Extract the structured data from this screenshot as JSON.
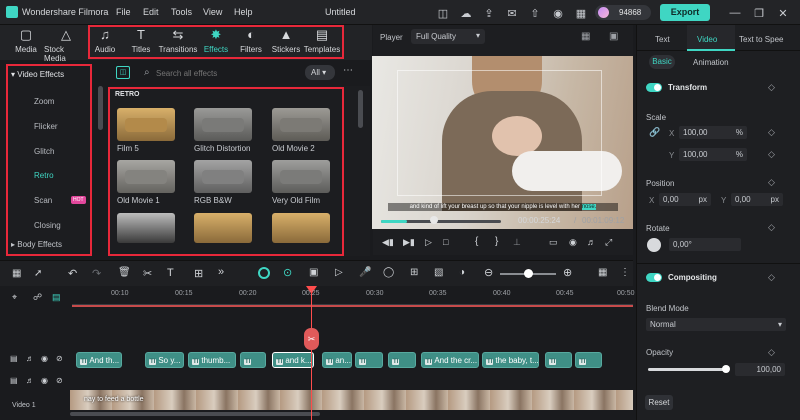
{
  "app": {
    "name": "Wondershare Filmora",
    "title": "Untitled",
    "menu": [
      "File",
      "Edit",
      "Tools",
      "View",
      "Help"
    ],
    "credits": "94868",
    "export_label": "Export"
  },
  "tabs": [
    {
      "label": "Media"
    },
    {
      "label": "Stock Media"
    },
    {
      "label": "Audio"
    },
    {
      "label": "Titles"
    },
    {
      "label": "Transitions"
    },
    {
      "label": "Effects"
    },
    {
      "label": "Filters"
    },
    {
      "label": "Stickers"
    },
    {
      "label": "Templates"
    }
  ],
  "categories": {
    "header": "Video Effects",
    "items": [
      "Zoom",
      "Flicker",
      "Glitch",
      "Retro",
      "Scan",
      "Closing"
    ],
    "selected": "Retro",
    "scan_badge": "HOT",
    "footer": "Body Effects"
  },
  "search": {
    "placeholder": "Search all effects",
    "filter": "All"
  },
  "assets": {
    "section": "RETRO",
    "items": [
      "Film 5",
      "Glitch Distortion",
      "Old Movie 2",
      "Old Movie 1",
      "RGB B&W",
      "Very Old Film"
    ]
  },
  "player": {
    "label": "Player",
    "quality": "Full Quality",
    "subtitle_main": "and kind of lift your breast up so that your nipple is level with her",
    "subtitle_hl": "nose.",
    "time_current": "00:00:25:24",
    "time_sep": "/",
    "time_total": "00:01:09:12",
    "progress": 0.22
  },
  "right": {
    "tabs": [
      "Text",
      "Video",
      "Text to Spee"
    ],
    "active_tab": "Video",
    "subtabs": [
      "Basic",
      "Animation"
    ],
    "transform": "Transform",
    "scale": "Scale",
    "scale_x": "100,00",
    "scale_y": "100,00",
    "unit_pct": "%",
    "position": "Position",
    "pos_x": "0,00",
    "pos_y": "0,00",
    "unit_px": "px",
    "rotate": "Rotate",
    "rotate_val": "0,00°",
    "compositing": "Compositing",
    "blend_mode": "Blend Mode",
    "blend_val": "Normal",
    "opacity": "Opacity",
    "opacity_val": "100,00",
    "reset": "Reset",
    "x": "X",
    "y": "Y"
  },
  "timeline": {
    "ticks": [
      "00:10",
      "00:15",
      "00:20",
      "00:25",
      "00:30",
      "00:35",
      "00:40",
      "00:45",
      "00:50"
    ],
    "clips": [
      "And th...",
      "So y...",
      "thumb...",
      "",
      "and k...",
      "an...",
      "",
      "",
      "And the cr...",
      "the baby, t...",
      ""
    ],
    "video_label": "Video 1",
    "video_caption": "nay to feed a bottle"
  },
  "colors": {
    "accent": "#3fd6c3",
    "red_box": "#e8283a",
    "clip": "#3f8f86",
    "playhead": "#ff4d4d"
  }
}
